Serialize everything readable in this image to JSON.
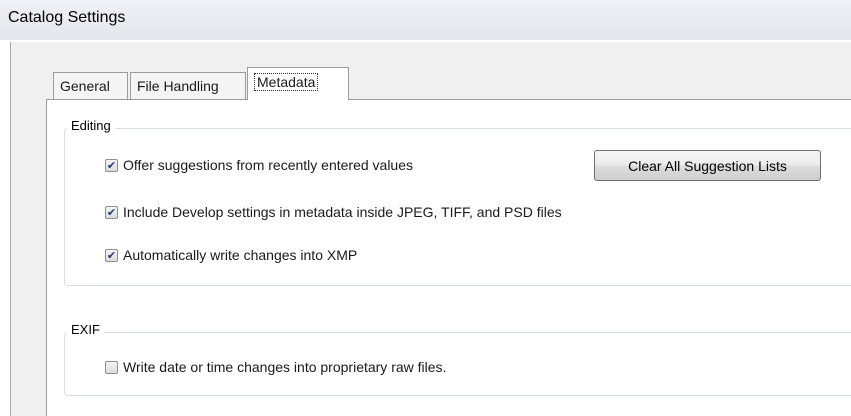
{
  "window": {
    "title": "Catalog Settings"
  },
  "tabs": [
    {
      "label": "General",
      "active": false
    },
    {
      "label": "File Handling",
      "active": false
    },
    {
      "label": "Metadata",
      "active": true
    }
  ],
  "editing": {
    "label": "Editing",
    "options": [
      {
        "label": "Offer suggestions from recently entered values",
        "checked": true,
        "check_glyph": "✔"
      },
      {
        "label": "Include Develop settings in metadata inside JPEG, TIFF, and PSD files",
        "checked": true,
        "check_glyph": "✔"
      },
      {
        "label": "Automatically write changes into XMP",
        "checked": true,
        "check_glyph": "✔"
      }
    ],
    "clear_button_label": "Clear All Suggestion Lists"
  },
  "exif": {
    "label": "EXIF",
    "options": [
      {
        "label": "Write date or time changes into proprietary raw files.",
        "checked": false,
        "check_glyph": ""
      }
    ]
  }
}
